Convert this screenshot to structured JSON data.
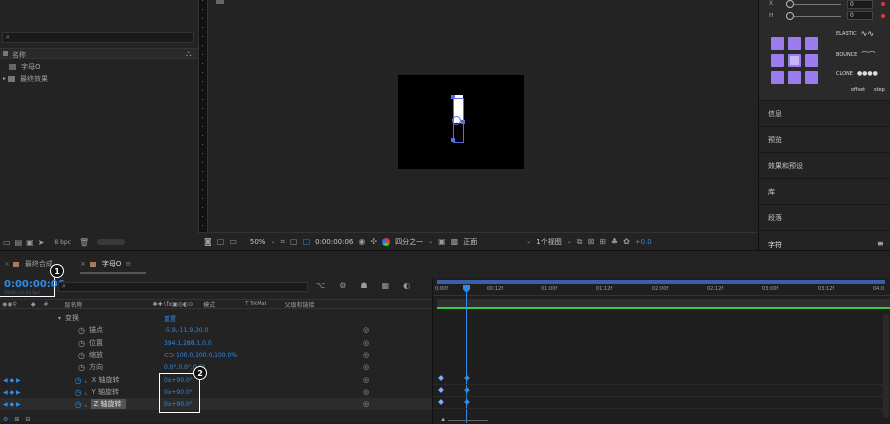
{
  "project": {
    "search_placeholder": "",
    "column_name": "名称",
    "items": [
      {
        "label": "字母O"
      },
      {
        "label": "最终效果"
      }
    ],
    "bpc": "8 bpc"
  },
  "viewer": {
    "zoom": "50%",
    "timecode": "0:00:00:06",
    "resolution": "四分之一",
    "view": "正面",
    "views_count": "1个视图",
    "exposure": "+0.0"
  },
  "easing": {
    "params": [
      {
        "label": "X",
        "value": "0"
      },
      {
        "label": "H",
        "value": "0"
      }
    ],
    "presets": [
      {
        "label": "ELASTIC"
      },
      {
        "label": "BOUNCE"
      },
      {
        "label": "CLONE"
      }
    ],
    "offset_label": "offset",
    "step_label": "step"
  },
  "right_panels": [
    {
      "label": "信息"
    },
    {
      "label": "预览"
    },
    {
      "label": "效果和预设"
    },
    {
      "label": "库"
    },
    {
      "label": "段落"
    },
    {
      "label": "字符"
    }
  ],
  "tabs": [
    {
      "label": "最终合成"
    },
    {
      "label": "字母O"
    }
  ],
  "timeline": {
    "current_time": "0:00:00:06",
    "current_time_sub": "00006 (25.00 fps)",
    "columns": {
      "hash": "#",
      "layer_name": "层名称",
      "mode": "模式",
      "trkmat": "T  TrkMat",
      "parent": "父级和链接"
    },
    "ruler_labels": [
      "0:00f",
      "00:12f",
      "01:00f",
      "01:12f",
      "02:00f",
      "02:12f",
      "03:00f",
      "03:12f",
      "04:0"
    ],
    "rows": [
      {
        "name": "变换",
        "value": "重置"
      },
      {
        "name": "锚点",
        "value": "-5.9,-11.9,30.0"
      },
      {
        "name": "位置",
        "value": "394.1,288.1,0.0"
      },
      {
        "name": "缩放",
        "value": "100.0,100.0,100.0%"
      },
      {
        "name": "方向",
        "value": "0.0°,0.0°,0.0°"
      },
      {
        "name": "X 轴旋转",
        "value": "0x+90.0°"
      },
      {
        "name": "Y 轴旋转",
        "value": "0x+90.0°"
      },
      {
        "name": "Z 轴旋转",
        "value": "0x+90.0°"
      }
    ],
    "callouts": [
      "1",
      "2"
    ]
  }
}
